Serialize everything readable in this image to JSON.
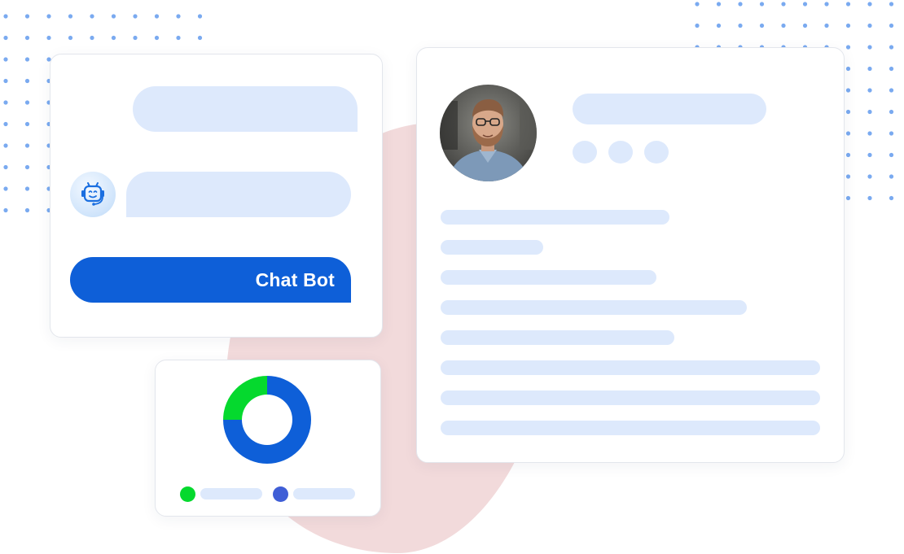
{
  "colors": {
    "accent_blue": "#0e5fd8",
    "placeholder_blue": "#dde9fc",
    "dot_blue": "#7aaaf0",
    "blob_pink": "#f2dadb",
    "chart_green": "#05d92e",
    "chart_blue": "#0e5fd8",
    "legend_blue": "#3f5ed6"
  },
  "chat": {
    "button_label": "Chat Bot",
    "bot_icon": "robot-headset-icon"
  },
  "profile": {
    "avatar_icon": "user-photo"
  },
  "chart_data": {
    "type": "pie",
    "donut": true,
    "values": [
      0.25,
      0.75
    ],
    "colors": [
      "#05d92e",
      "#0e5fd8"
    ]
  }
}
